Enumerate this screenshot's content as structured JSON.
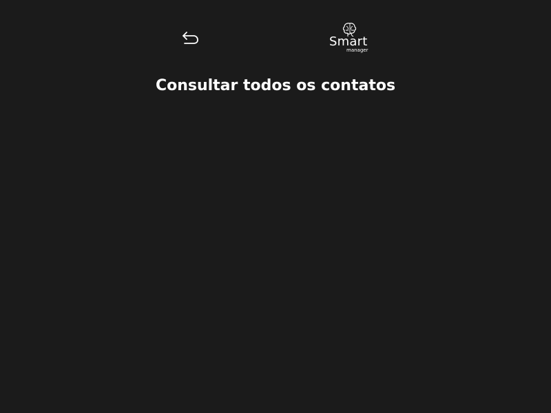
{
  "header": {
    "back_icon": "back-arrow-icon",
    "logo": {
      "mark_icon": "brain-icon",
      "name": "Smart",
      "subtitle": "manager"
    }
  },
  "main": {
    "title": "Consultar todos os contatos"
  },
  "colors": {
    "background": "#1b1b1b",
    "text": "#ffffff"
  }
}
